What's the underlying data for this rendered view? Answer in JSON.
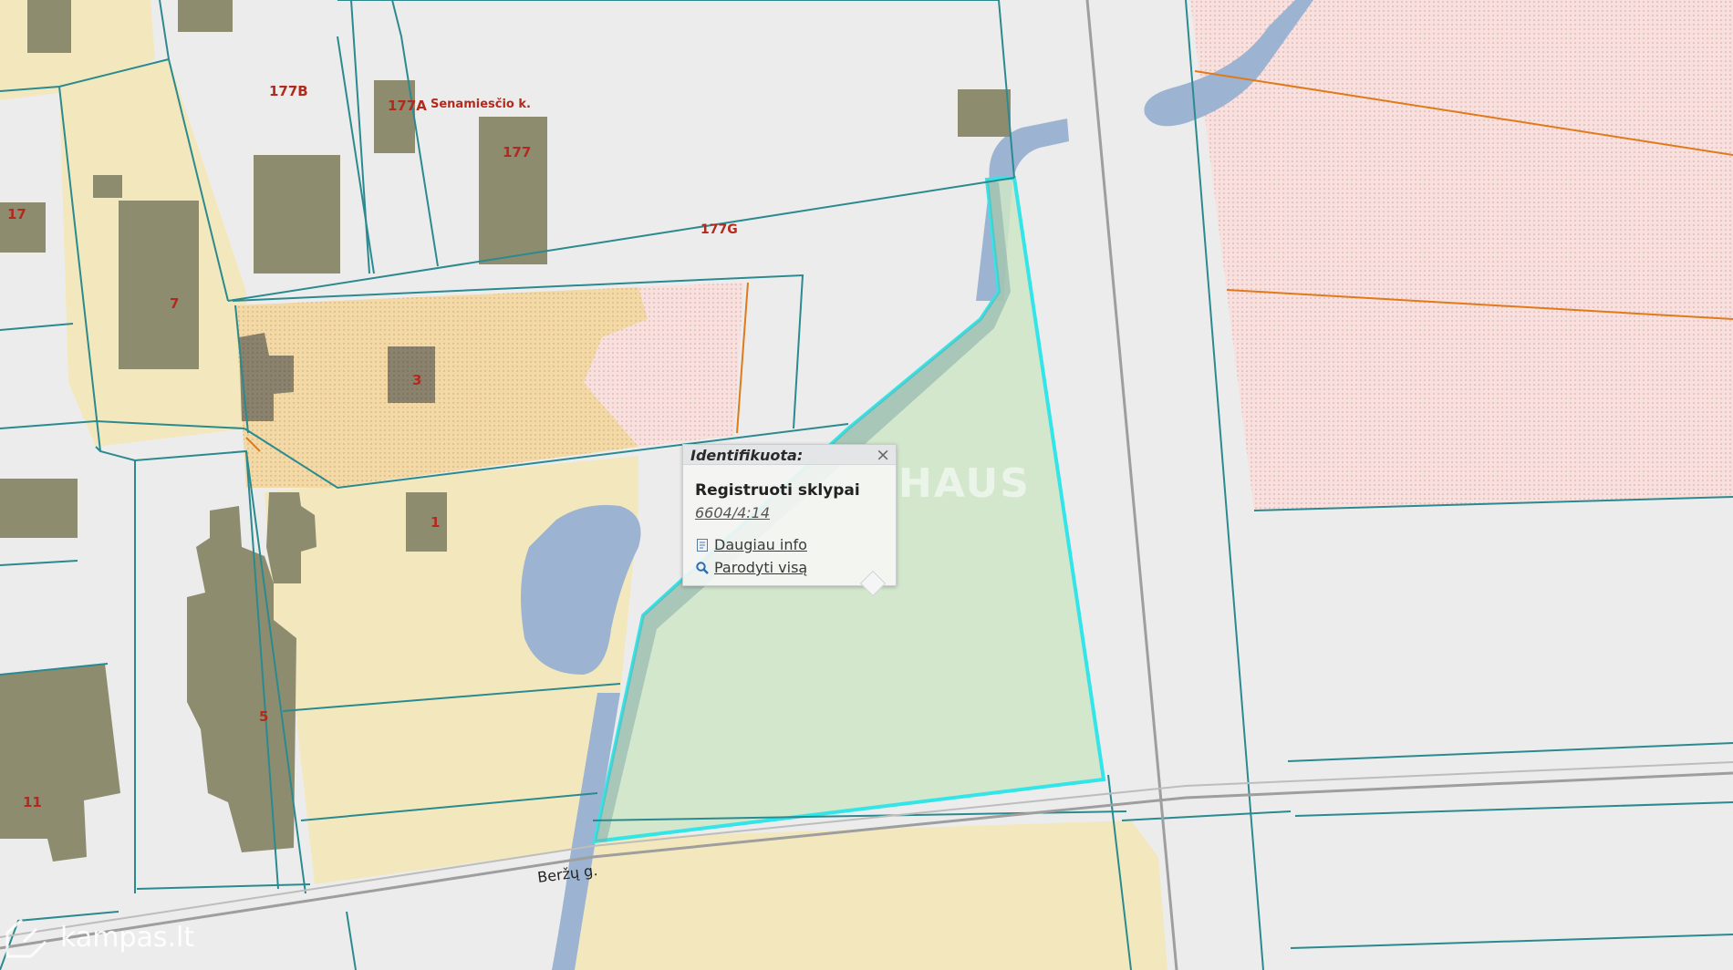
{
  "map": {
    "parcel_labels": {
      "p177b": "177B",
      "p177a": "177A",
      "p177": "177",
      "p177g": "177G",
      "p17": "17",
      "p7": "7",
      "p3": "3",
      "p1": "1",
      "p5": "5",
      "p11": "11"
    },
    "place_label": "Senamiesčio k.",
    "road_label": "Beržų g.",
    "watermark": "HAUS",
    "brand": "kampas.lt"
  },
  "popup": {
    "header": "Identifikuota:",
    "close": "×",
    "title": "Registruoti sklypai",
    "parcel_id": "6604/4:14",
    "more_info": "Daugiau info",
    "show_all": "Parodyti visą",
    "more_info_icon": "document-icon",
    "show_all_icon": "magnifier-icon"
  },
  "colors": {
    "background": "#ececec",
    "building": "#8e8c6f",
    "yellow_zone": "#f3e8bd",
    "orange_zone": "#f2d8a4",
    "pink_zone": "#f6dcd8",
    "water": "#9cb4d2",
    "parcel_line": "#2a8a8f",
    "selected_fill": "#cfe6c8",
    "selected_outline": "#33e5e8",
    "orange_line": "#e07a1a"
  }
}
